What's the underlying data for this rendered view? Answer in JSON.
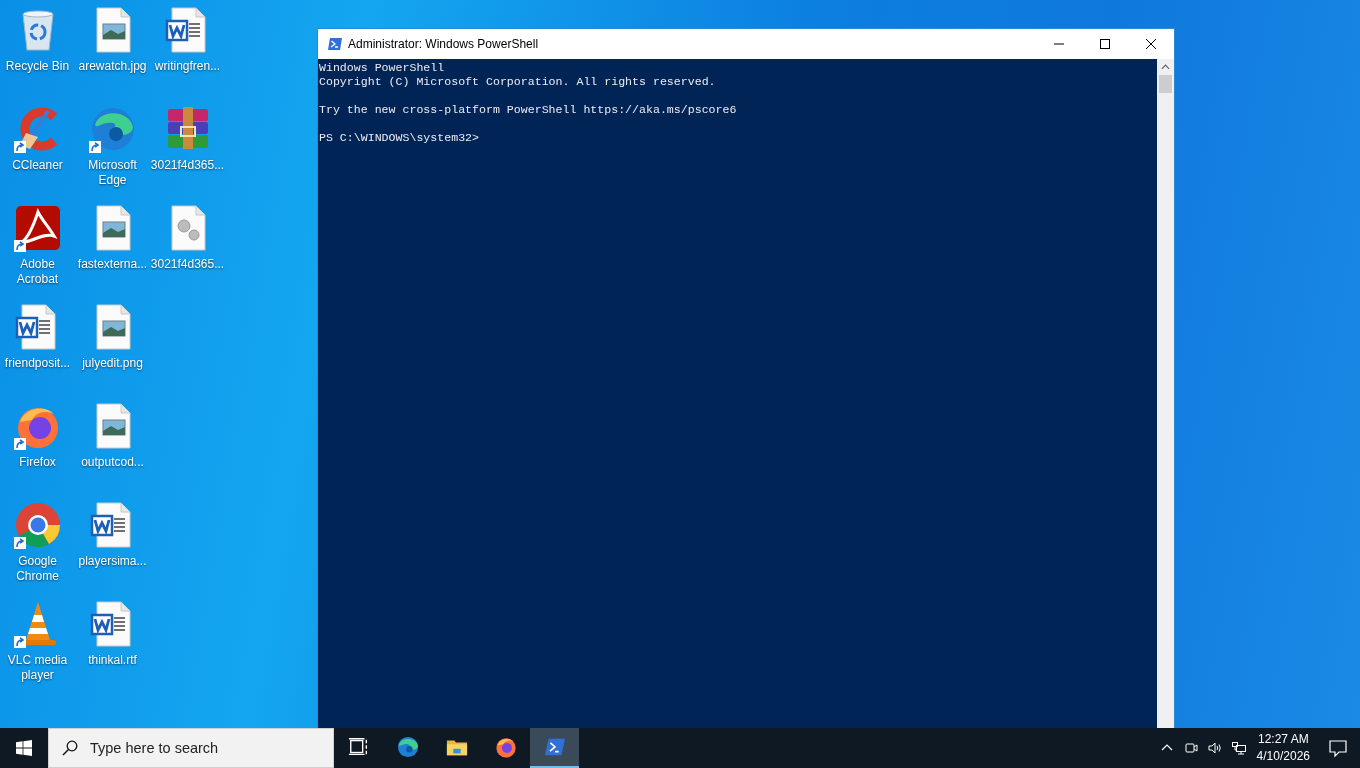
{
  "desktop_icons": [
    {
      "label": "Recycle Bin",
      "kind": "recycle-bin",
      "shortcut": false
    },
    {
      "label": "CCleaner",
      "kind": "ccleaner",
      "shortcut": true
    },
    {
      "label": "Adobe Acrobat",
      "kind": "acrobat",
      "shortcut": true
    },
    {
      "label": "friendposit...",
      "kind": "word-file",
      "shortcut": false
    },
    {
      "label": "Firefox",
      "kind": "firefox",
      "shortcut": true
    },
    {
      "label": "Google Chrome",
      "kind": "chrome",
      "shortcut": true
    },
    {
      "label": "VLC media player",
      "kind": "vlc",
      "shortcut": true
    },
    {
      "label": "arewatch.jpg",
      "kind": "image-file",
      "shortcut": false
    },
    {
      "label": "Microsoft Edge",
      "kind": "edge",
      "shortcut": true
    },
    {
      "label": "fastexterna...",
      "kind": "image-file",
      "shortcut": false
    },
    {
      "label": "julyedit.png",
      "kind": "image-file",
      "shortcut": false
    },
    {
      "label": "outputcod...",
      "kind": "image-file",
      "shortcut": false
    },
    {
      "label": "playersima...",
      "kind": "word-file",
      "shortcut": false
    },
    {
      "label": "thinkal.rtf",
      "kind": "word-file",
      "shortcut": false
    },
    {
      "label": "writingfren...",
      "kind": "word-file",
      "shortcut": false
    },
    {
      "label": "3021f4d365...",
      "kind": "archive",
      "shortcut": false
    },
    {
      "label": "3021f4d365...",
      "kind": "settings-file",
      "shortcut": false
    }
  ],
  "window": {
    "title": "Administrator: Windows PowerShell",
    "console_blocks": [
      [
        "Windows PowerShell",
        "Copyright (C) Microsoft Corporation. All rights reserved."
      ],
      [
        "Try the new cross-platform PowerShell https://aka.ms/pscore6"
      ],
      [
        "PS C:\\WINDOWS\\system32>"
      ]
    ]
  },
  "taskbar": {
    "search": {
      "placeholder": "Type here to search"
    },
    "apps": [
      {
        "kind": "task-view",
        "selected": false
      },
      {
        "kind": "edge",
        "selected": false
      },
      {
        "kind": "file-explorer",
        "selected": false
      },
      {
        "kind": "firefox",
        "selected": false
      },
      {
        "kind": "powershell",
        "selected": true
      }
    ],
    "clock": {
      "time": "12:27 AM",
      "date": "4/10/2026"
    }
  }
}
